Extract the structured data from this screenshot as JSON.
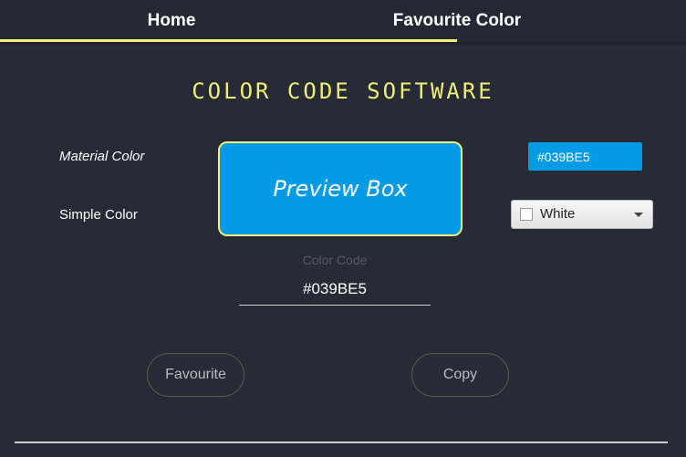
{
  "tabs": [
    {
      "label": "Home",
      "selected": true
    },
    {
      "label": "Favourite Color",
      "selected": false
    }
  ],
  "app_title": "COLOR CODE SOFTWARE",
  "material_color": {
    "label": "Material Color",
    "value": "#039BE5"
  },
  "simple_color": {
    "label": "Simple Color",
    "selected": "White"
  },
  "preview": {
    "label": "Preview Box",
    "color": "#039BE5"
  },
  "color_code": {
    "label": "Color Code",
    "value": "#039BE5"
  },
  "buttons": {
    "favourite": "Favourite",
    "copy": "Copy"
  },
  "colors": {
    "background": "#262b36",
    "accent": "#f2ee7a",
    "preview_fill": "#039be5"
  }
}
